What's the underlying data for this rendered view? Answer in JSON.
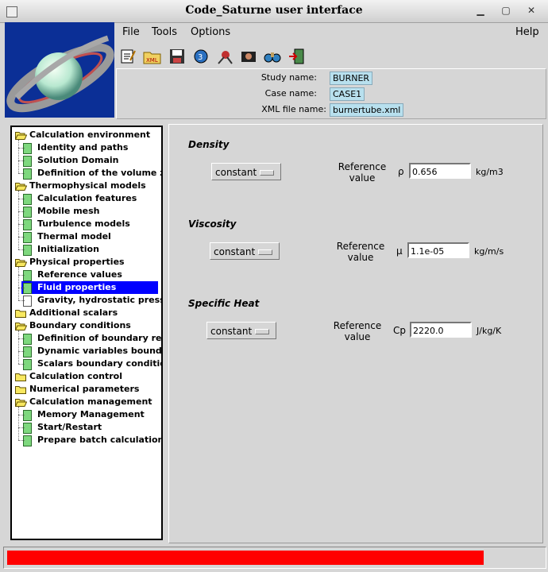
{
  "window": {
    "title": "Code_Saturne user interface"
  },
  "menubar": {
    "file": "File",
    "tools": "Tools",
    "options": "Options",
    "help": "Help"
  },
  "toolbar": [
    "new-file-icon",
    "open-xml-icon",
    "save-icon",
    "run-icon",
    "satellite-icon",
    "camera-icon",
    "binoculars-icon",
    "exit-icon"
  ],
  "study": {
    "study_label": "Study name:",
    "study_value": "BURNER",
    "case_label": "Case name:",
    "case_value": "CASE1",
    "xml_label": "XML file name:",
    "xml_value": "burnertube.xml"
  },
  "tree": [
    {
      "label": "Calculation environment",
      "level": 0,
      "icon": "folder-open"
    },
    {
      "label": "Identity and paths",
      "level": 1,
      "icon": "doc"
    },
    {
      "label": "Solution Domain",
      "level": 1,
      "icon": "doc"
    },
    {
      "label": "Definition of the volume zones",
      "level": 1,
      "icon": "doc"
    },
    {
      "label": "Thermophysical models",
      "level": 0,
      "icon": "folder-open"
    },
    {
      "label": "Calculation features",
      "level": 1,
      "icon": "doc"
    },
    {
      "label": "Mobile mesh",
      "level": 1,
      "icon": "doc"
    },
    {
      "label": "Turbulence models",
      "level": 1,
      "icon": "doc"
    },
    {
      "label": "Thermal model",
      "level": 1,
      "icon": "doc"
    },
    {
      "label": "Initialization",
      "level": 1,
      "icon": "doc"
    },
    {
      "label": "Physical properties",
      "level": 0,
      "icon": "folder-open"
    },
    {
      "label": "Reference values",
      "level": 1,
      "icon": "doc"
    },
    {
      "label": "Fluid properties",
      "level": 1,
      "icon": "doc",
      "selected": true
    },
    {
      "label": "Gravity, hydrostatic pressure",
      "level": 1,
      "icon": "doc-white"
    },
    {
      "label": "Additional scalars",
      "level": 0,
      "icon": "folder"
    },
    {
      "label": "Boundary conditions",
      "level": 0,
      "icon": "folder-open"
    },
    {
      "label": "Definition of boundary regions",
      "level": 1,
      "icon": "doc"
    },
    {
      "label": "Dynamic variables bound. cond.",
      "level": 1,
      "icon": "doc"
    },
    {
      "label": "Scalars boundary conditions",
      "level": 1,
      "icon": "doc"
    },
    {
      "label": "Calculation control",
      "level": 0,
      "icon": "folder"
    },
    {
      "label": "Numerical parameters",
      "level": 0,
      "icon": "folder"
    },
    {
      "label": "Calculation management",
      "level": 0,
      "icon": "folder-open"
    },
    {
      "label": "Memory Management",
      "level": 1,
      "icon": "doc"
    },
    {
      "label": "Start/Restart",
      "level": 1,
      "icon": "doc"
    },
    {
      "label": "Prepare batch calculation",
      "level": 1,
      "icon": "doc"
    }
  ],
  "density": {
    "title": "Density",
    "mode": "constant",
    "ref_label": "Reference value",
    "symbol": "ρ",
    "value": "0.656",
    "unit": "kg/m3"
  },
  "viscosity": {
    "title": "Viscosity",
    "mode": "constant",
    "ref_label": "Reference value",
    "symbol": "μ",
    "value": "1.1e-05",
    "unit": "kg/m/s"
  },
  "specific_heat": {
    "title": "Specific Heat",
    "mode": "constant",
    "ref_label": "Reference value",
    "symbol": "Cp",
    "value": "2220.0",
    "unit": "J/kg/K"
  },
  "status": {
    "progress": 0.89,
    "color": "#ff0000"
  }
}
